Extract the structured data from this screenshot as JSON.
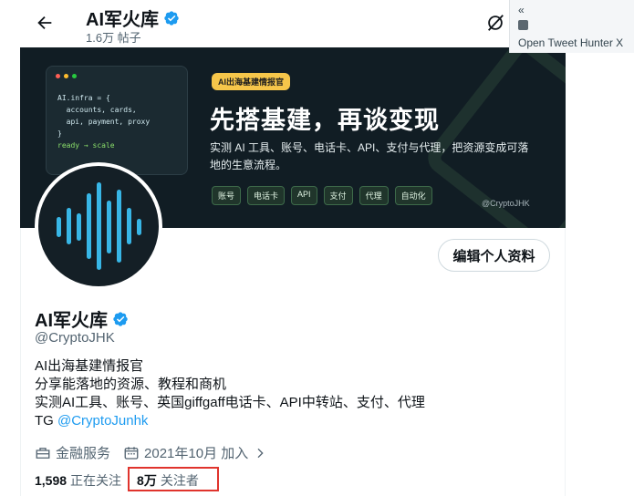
{
  "header": {
    "title": "AI军火库",
    "post_count": "1.6万 帖子"
  },
  "banner": {
    "code_lines": [
      "AI.infra = {",
      "  accounts, cards,",
      "  api, payment, proxy",
      "}"
    ],
    "code_footer": "ready → scale",
    "tag": "AI出海基建情报官",
    "headline": "先搭基建，再谈变现",
    "description": "实测 AI 工具、账号、电话卡、API、支付与代理，把资源变成可落地的生意流程。",
    "chips": [
      "账号",
      "电话卡",
      "API",
      "支付",
      "代理",
      "自动化"
    ],
    "handle": "@CryptoJHK"
  },
  "actions": {
    "edit_profile": "编辑个人资料"
  },
  "profile": {
    "name": "AI军火库",
    "handle": "@CryptoJHK",
    "bio_lines": [
      "AI出海基建情报官",
      "分享能落地的资源、教程和商机",
      "实测AI工具、账号、英国giffgaff电话卡、API中转站、支付、代理"
    ],
    "tg_prefix": "TG ",
    "tg_link": "@CryptoJunhk",
    "category": "金融服务",
    "joined": "2021年10月 加入",
    "following_count": "1,598",
    "following_label": "正在关注",
    "followers_count": "8万",
    "followers_label": "关注者"
  },
  "extension": {
    "collapse": "«",
    "label": "Open Tweet Hunter X"
  },
  "colors": {
    "accent": "#1d9bf0",
    "highlight": "#e0342d",
    "banner_bg": "#111d24",
    "avatar_bars": "#38b6e6"
  }
}
